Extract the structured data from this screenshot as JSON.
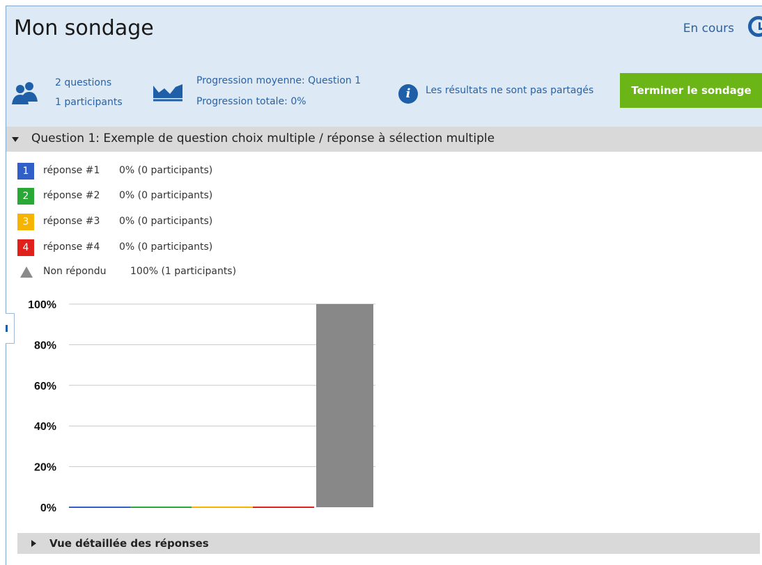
{
  "header": {
    "title": "Mon sondage",
    "status": "En cours",
    "status_icon": "clock-icon"
  },
  "stats": {
    "questions": "2 questions",
    "participants": "1 participants",
    "avg_progress": "Progression moyenne: Question 1",
    "total_progress": "Progression totale: 0%",
    "sharing": "Les résultats ne sont pas partagés",
    "finish_button": "Terminer le sondage",
    "icons": [
      "people-icon",
      "chart-icon",
      "info-icon"
    ]
  },
  "question": {
    "label": "Question 1: Exemple de question choix multiple / réponse à sélection multiple"
  },
  "legend": [
    {
      "num": "1",
      "label": "réponse #1",
      "value": "0% (0 participants)",
      "color": "#2f5fc7"
    },
    {
      "num": "2",
      "label": "réponse #2",
      "value": "0% (0 participants)",
      "color": "#2aa836"
    },
    {
      "num": "3",
      "label": "réponse #3",
      "value": "0% (0 participants)",
      "color": "#f6b400"
    },
    {
      "num": "4",
      "label": "réponse #4",
      "value": "0% (0 participants)",
      "color": "#e0201b"
    },
    {
      "num": "",
      "label": "Non répondu",
      "value": "100% (1 participants)",
      "color": "#8a8a8a"
    }
  ],
  "chart_data": {
    "type": "bar",
    "categories": [
      "réponse #1",
      "réponse #2",
      "réponse #3",
      "réponse #4",
      "Non répondu"
    ],
    "values": [
      0,
      0,
      0,
      0,
      100
    ],
    "colors": [
      "#2f5fc7",
      "#2aa836",
      "#f6b400",
      "#e0201b",
      "#888888"
    ],
    "ylim": [
      0,
      100
    ],
    "yticks": [
      "0%",
      "20%",
      "40%",
      "60%",
      "80%",
      "100%"
    ],
    "grid": true,
    "xlabel": "",
    "ylabel": ""
  },
  "detail": {
    "label": "Vue détaillée des réponses"
  }
}
